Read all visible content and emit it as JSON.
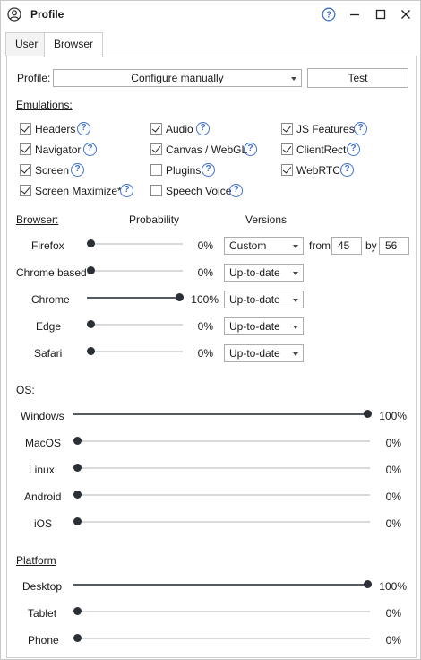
{
  "window": {
    "title": "Profile",
    "icons": {
      "app": "user-circle-icon",
      "help": "help-icon",
      "minimize": "minimize-icon",
      "maximize": "maximize-icon",
      "close": "close-icon"
    }
  },
  "tabs": [
    {
      "label": "User",
      "active": false
    },
    {
      "label": "Browser",
      "active": true
    }
  ],
  "profile": {
    "label": "Profile:",
    "value": "Configure manually",
    "test_button": "Test"
  },
  "emulations": {
    "title": "Emulations:",
    "items": [
      {
        "label": "Headers",
        "checked": true
      },
      {
        "label": "Navigator",
        "checked": true
      },
      {
        "label": "Screen",
        "checked": true
      },
      {
        "label": "Screen Maximize*",
        "checked": true
      },
      {
        "label": "Audio",
        "checked": true
      },
      {
        "label": "Canvas / WebGL",
        "checked": true
      },
      {
        "label": "Plugins",
        "checked": false
      },
      {
        "label": "Speech Voice",
        "checked": false
      },
      {
        "label": "JS Features",
        "checked": true
      },
      {
        "label": "ClientRect",
        "checked": true
      },
      {
        "label": "WebRTC",
        "checked": true
      }
    ]
  },
  "browser": {
    "title": "Browser:",
    "probability_header": "Probability",
    "versions_header": "Versions",
    "from_label": "from",
    "by_label": "by",
    "rows": [
      {
        "name": "Firefox",
        "value": 0,
        "percent": "0%",
        "version": "Custom",
        "from": "45",
        "by": "56"
      },
      {
        "name": "Chrome based",
        "value": 0,
        "percent": "0%",
        "version": "Up-to-date"
      },
      {
        "name": "Chrome",
        "value": 100,
        "percent": "100%",
        "version": "Up-to-date"
      },
      {
        "name": "Edge",
        "value": 0,
        "percent": "0%",
        "version": "Up-to-date"
      },
      {
        "name": "Safari",
        "value": 0,
        "percent": "0%",
        "version": "Up-to-date"
      }
    ]
  },
  "os": {
    "title": "OS:",
    "rows": [
      {
        "name": "Windows",
        "value": 100,
        "percent": "100%"
      },
      {
        "name": "MacOS",
        "value": 0,
        "percent": "0%"
      },
      {
        "name": "Linux",
        "value": 0,
        "percent": "0%"
      },
      {
        "name": "Android",
        "value": 0,
        "percent": "0%"
      },
      {
        "name": "iOS",
        "value": 0,
        "percent": "0%"
      }
    ]
  },
  "platform": {
    "title": "Platform",
    "rows": [
      {
        "name": "Desktop",
        "value": 100,
        "percent": "100%"
      },
      {
        "name": "Tablet",
        "value": 0,
        "percent": "0%"
      },
      {
        "name": "Phone",
        "value": 0,
        "percent": "0%"
      }
    ]
  },
  "colors": {
    "help_blue": "#3f6fd0",
    "slider_thumb": "#2b2f36",
    "slider_fill": "#555a63"
  }
}
